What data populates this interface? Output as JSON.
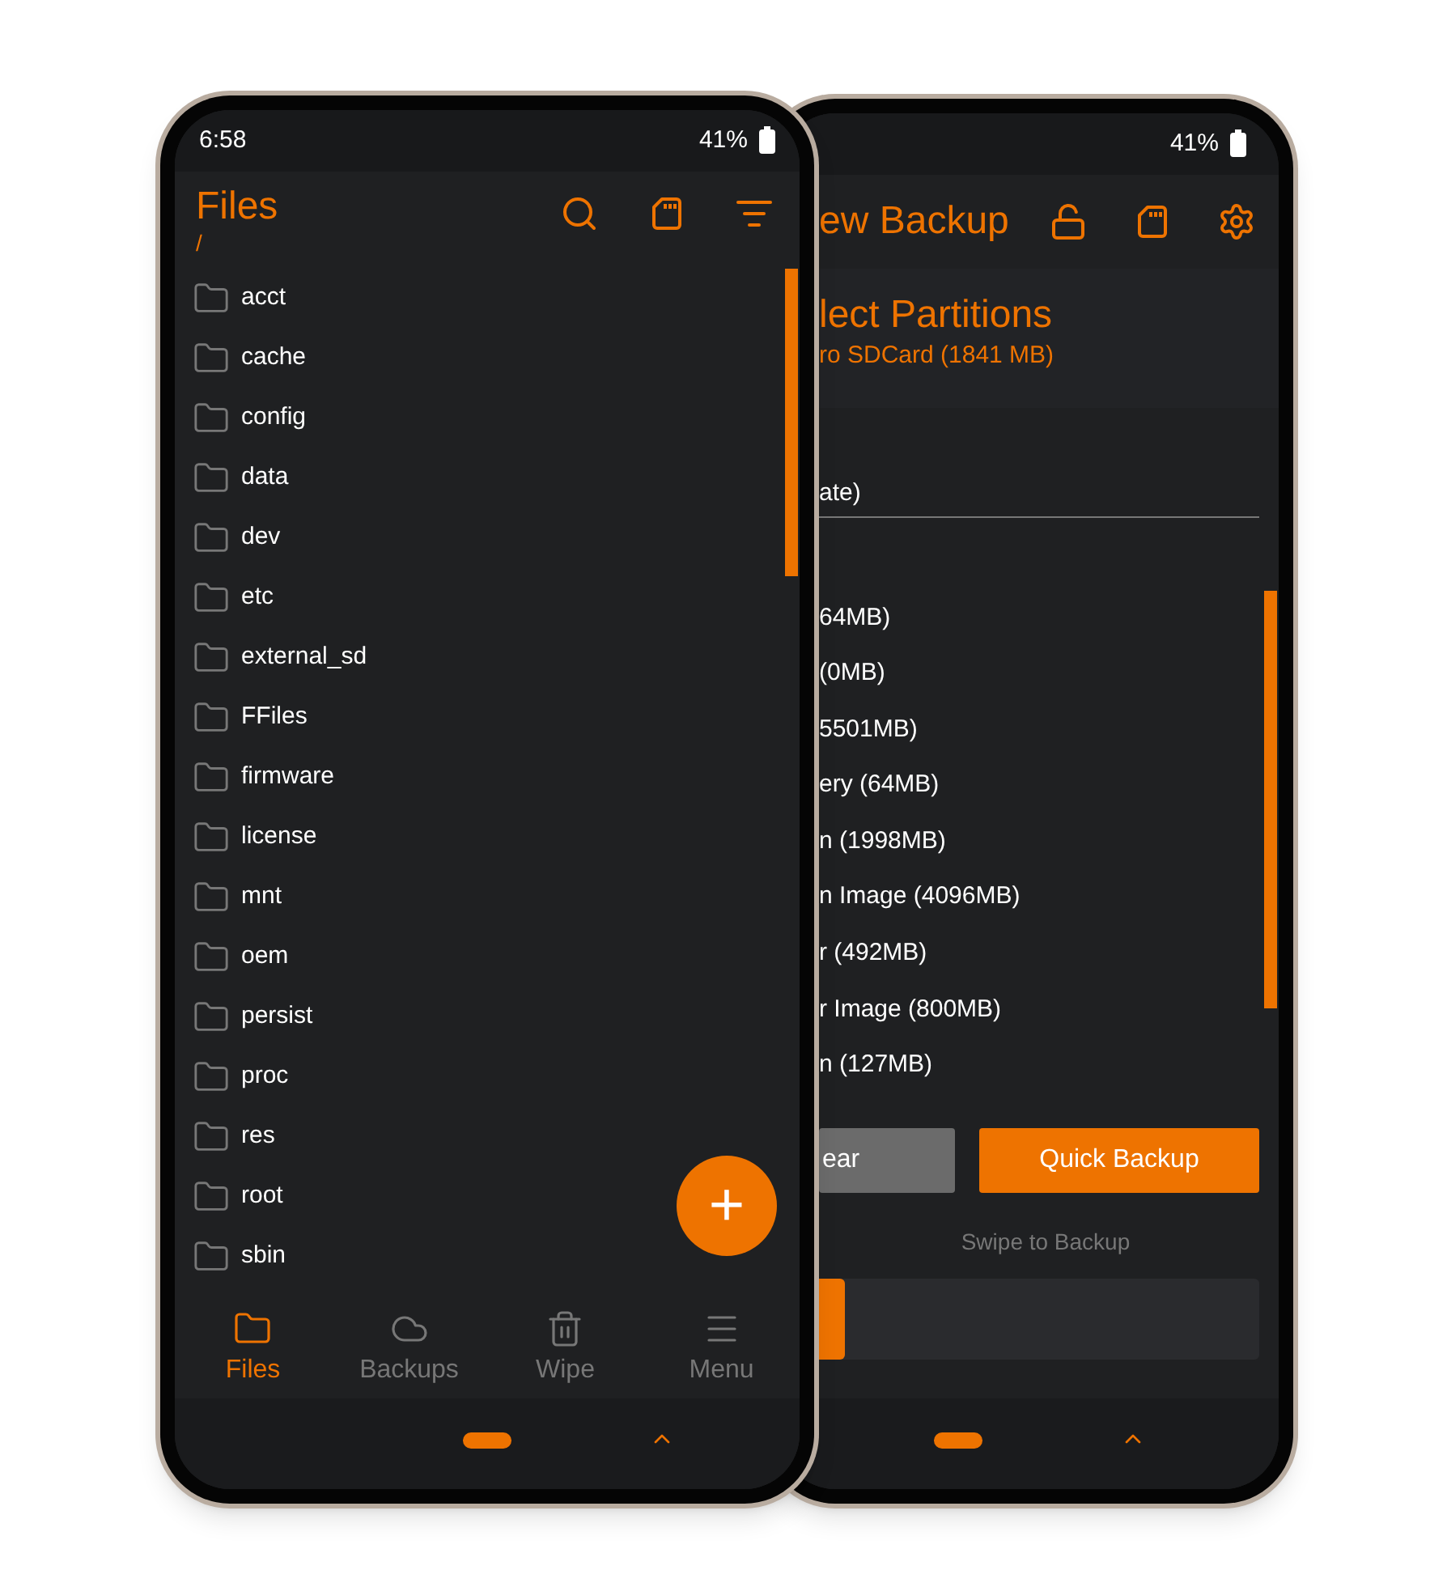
{
  "files_phone": {
    "status_bar": {
      "time": "6:58",
      "battery": "41%"
    },
    "header": {
      "title": "Files",
      "path": "/"
    },
    "folders": [
      "acct",
      "cache",
      "config",
      "data",
      "dev",
      "etc",
      "external_sd",
      "FFiles",
      "firmware",
      "license",
      "mnt",
      "oem",
      "persist",
      "proc",
      "res",
      "root",
      "sbin"
    ],
    "fab": {
      "label": "+"
    },
    "nav": [
      {
        "label": "Files",
        "kind": "folder",
        "selected": true
      },
      {
        "label": "Backups",
        "kind": "cloud",
        "selected": false
      },
      {
        "label": "Wipe",
        "kind": "trash",
        "selected": false
      },
      {
        "label": "Menu",
        "kind": "menu",
        "selected": false
      }
    ]
  },
  "backup_phone": {
    "status_bar": {
      "battery": "41%"
    },
    "header": {
      "title": "ew Backup"
    },
    "section": {
      "title": "lect Partitions",
      "subtitle": "ro SDCard (1841 MB)"
    },
    "name_field": {
      "value": "ate)"
    },
    "partitions": [
      "64MB)",
      "(0MB)",
      "5501MB)",
      "ery (64MB)",
      "n (1998MB)",
      "n Image (4096MB)",
      "r (492MB)",
      "r Image (800MB)",
      "n (127MB)"
    ],
    "buttons": [
      {
        "label": "ear",
        "kind": "secondary"
      },
      {
        "label": "Quick Backup",
        "kind": "primary"
      }
    ],
    "swipe_label": "Swipe to Backup"
  }
}
